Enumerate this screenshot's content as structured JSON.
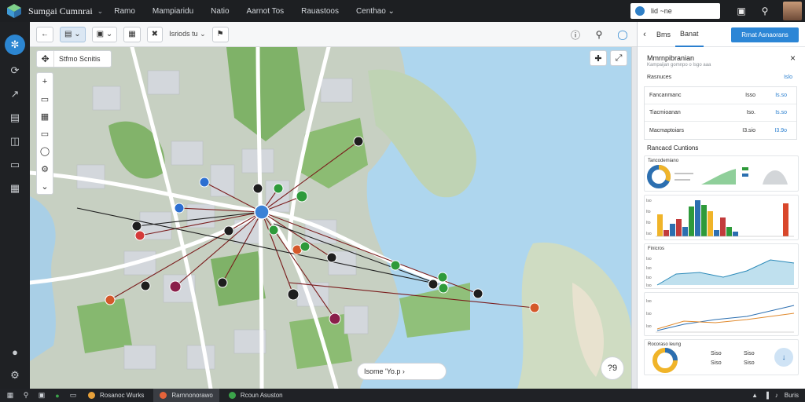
{
  "app": {
    "title": "Sumgai Cumnrai",
    "menu": [
      "Ramo",
      "Mampiaridu",
      "Natio",
      "Aarnot Tos",
      "Rauastoos",
      "Centhao"
    ]
  },
  "topbar": {
    "search_value": "lid ~ne",
    "icons": [
      "layout-icon",
      "search-icon"
    ],
    "avatar": "user-avatar"
  },
  "rail": {
    "items": [
      "compass-icon",
      "route-icon",
      "chart-icon",
      "gallery-icon",
      "book-icon",
      "doc-icon",
      "data-icon",
      "chat-icon",
      "settings-icon"
    ]
  },
  "toolbar": {
    "buttons": [
      "back-icon",
      "layers-icon",
      "select-icon",
      "stamp-icon",
      "tools-icon"
    ],
    "dropdown_label": "Isriods tu",
    "right_icons": [
      "info-icon",
      "pin-icon",
      "shield-icon"
    ]
  },
  "map": {
    "search_text": "Stfmo  Scnitis",
    "bottom_text": "Isome  'Yo.p  ›",
    "round_label": "?9",
    "colors": {
      "water": "#aed6ee",
      "land": "#c9d3c4",
      "park": "#7fb268",
      "road": "#ffffff",
      "line_dark": "#7a1c1c",
      "line_black": "#1e1e1e",
      "hub": "#3b82d6"
    }
  },
  "panel": {
    "tabs": [
      "Bms",
      "Banat"
    ],
    "primary_button": "Rrnat Asnaorans",
    "title": "Mmrnpibranian",
    "subtitle": "Kampaijan gomnpo o  Isgo  aaa",
    "summary": {
      "label": "Rasnuces",
      "value": "Islo"
    },
    "table": [
      {
        "label": "Fancanmanc",
        "v1": "Isso",
        "v2": "Is.so"
      },
      {
        "label": "Tiacmioanan",
        "v1": "Iso.",
        "v2": "Is.so"
      },
      {
        "label": "Macmaptoiars",
        "v1": "I3.sio",
        "v2": "I3.9o"
      }
    ],
    "section_title": "Rancacd Cuntions",
    "cards": {
      "donut_title": "Tancodemiano",
      "bar_axis": [
        "Iso",
        "Ito",
        "Ito",
        "Iso"
      ],
      "line1_title": "Finicros",
      "line1_axis": [
        "Iso",
        "Iso",
        "Iso",
        "Iso"
      ],
      "line2_axis": [
        "Iso",
        "Iso",
        "Iso"
      ],
      "bottom_title": "Rocoraso leung",
      "bottom_vals": [
        "Siso",
        "Siso",
        "Siso",
        "Siso"
      ]
    }
  },
  "taskbar": {
    "apps": [
      "Rosanoc Wurks",
      "Rarnnonorawo",
      "Rcoun Asuston"
    ],
    "tray": [
      "▲",
      "▐",
      "♪",
      "Buris"
    ]
  }
}
